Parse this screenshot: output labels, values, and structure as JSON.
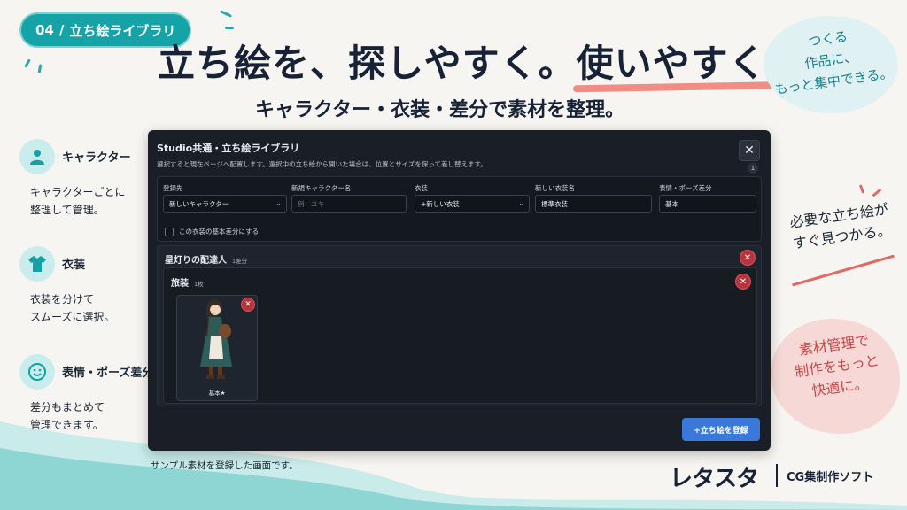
{
  "badge": {
    "number": "04",
    "separator": "/",
    "label": "立ち絵ライブラリ"
  },
  "headline": {
    "part1": "立ち絵を、探しやすく。",
    "part2": "使いやすく。"
  },
  "subheadline": "キャラクター・衣装・差分で素材を整理。",
  "notes": {
    "top": [
      "つくる",
      "作品に、",
      "もっと集中できる。"
    ],
    "middle": [
      "必要な立ち絵が",
      "すぐ見つかる。"
    ],
    "bottom": [
      "素材管理で",
      "制作をもっと",
      "快適に。"
    ]
  },
  "features": [
    {
      "icon": "person-icon",
      "title": "キャラクター",
      "desc": [
        "キャラクターごとに",
        "整理して管理。"
      ]
    },
    {
      "icon": "shirt-icon",
      "title": "衣装",
      "desc": [
        "衣装を分けて",
        "スムーズに選択。"
      ]
    },
    {
      "icon": "smiley-icon",
      "title": "表情・ポーズ差分",
      "desc": [
        "差分もまとめて",
        "管理できます。"
      ]
    }
  ],
  "dialog": {
    "title": "Studio共通・立ち絵ライブラリ",
    "description": "選択すると現在ページへ配置します。選択中の立ち絵から開いた場合は、位置とサイズを保って差し替えます。",
    "close": "✕",
    "count": "1",
    "form": {
      "register_to_label": "登録先",
      "register_to_value": "新しいキャラクター",
      "new_char_label": "新規キャラクター名",
      "new_char_placeholder": "例：ユキ",
      "outfit_label": "衣装",
      "outfit_value": "+新しい衣装",
      "new_outfit_label": "新しい衣装名",
      "new_outfit_value": "標準衣装",
      "expression_label": "表情・ポーズ差分",
      "expression_value": "基本",
      "checkbox_label": "この衣装の基本差分にする"
    },
    "character": {
      "name": "星灯りの配達人",
      "count": "1差分",
      "outfit": {
        "name": "旅装",
        "count": "1枚",
        "cards": [
          {
            "label": "基本★"
          }
        ]
      }
    },
    "register_button": "+立ち絵を登録"
  },
  "caption": "サンプル素材を登録した画面です。",
  "logo": {
    "name": "レタスタ",
    "tagline": "CG集制作ソフト"
  },
  "colors": {
    "accent": "#16a3a8",
    "danger": "#b8343d",
    "primary": "#3a79d9",
    "panel": "#1a1f27"
  }
}
